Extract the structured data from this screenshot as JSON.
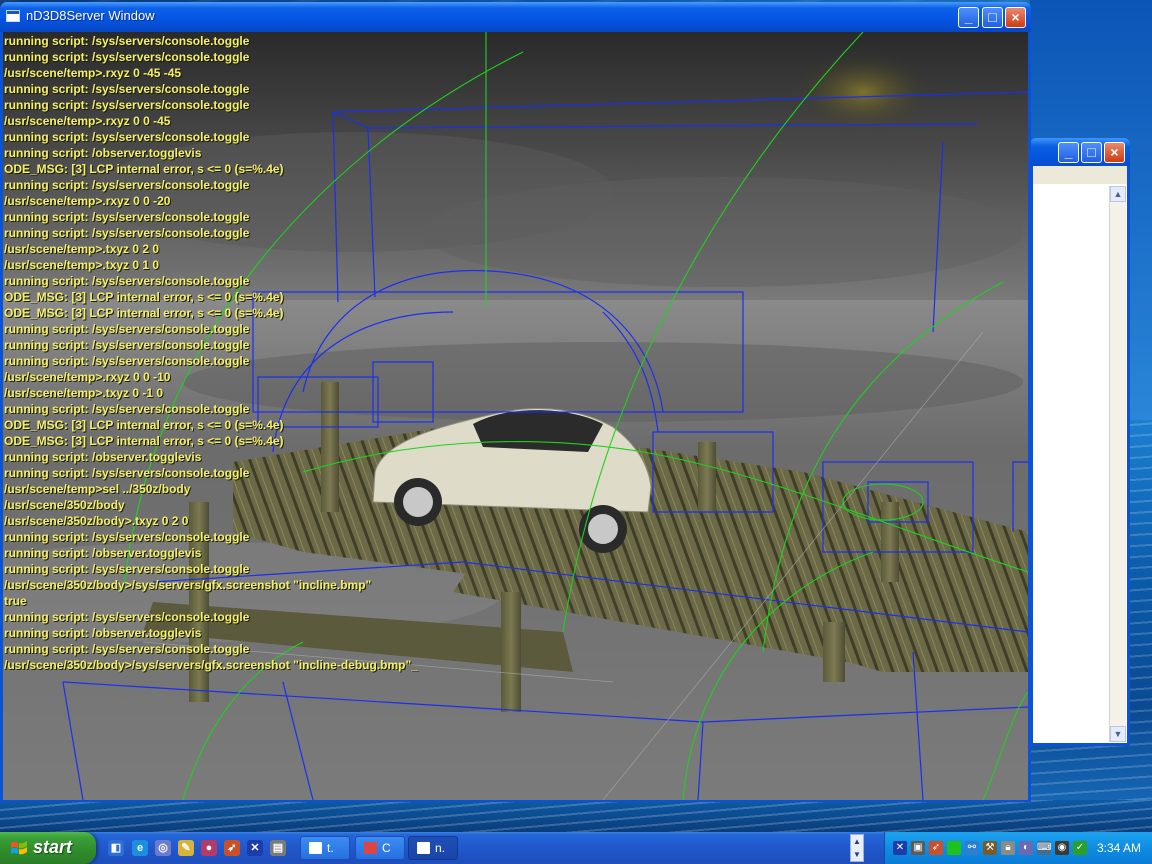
{
  "window": {
    "title": "nD3D8Server Window",
    "minimize_glyph": "_",
    "maximize_glyph": "□",
    "close_glyph": "×"
  },
  "console": {
    "lines": [
      "running script: /sys/servers/console.toggle",
      "running script: /sys/servers/console.toggle",
      "/usr/scene/temp>.rxyz 0 -45 -45",
      "running script: /sys/servers/console.toggle",
      "running script: /sys/servers/console.toggle",
      "/usr/scene/temp>.rxyz 0 0 -45",
      "running script: /sys/servers/console.toggle",
      "running script: /observer.togglevis",
      "ODE_MSG: [3] LCP internal error, s <= 0 (s=%.4e)",
      "running script: /sys/servers/console.toggle",
      "/usr/scene/temp>.rxyz 0 0 -20",
      "running script: /sys/servers/console.toggle",
      "running script: /sys/servers/console.toggle",
      "/usr/scene/temp>.txyz 0 2 0",
      "/usr/scene/temp>.txyz 0 1 0",
      "running script: /sys/servers/console.toggle",
      "ODE_MSG: [3] LCP internal error, s <= 0 (s=%.4e)",
      "ODE_MSG: [3] LCP internal error, s <= 0 (s=%.4e)",
      "running script: /sys/servers/console.toggle",
      "running script: /sys/servers/console.toggle",
      "running script: /sys/servers/console.toggle",
      "/usr/scene/temp>.rxyz 0 0 -10",
      "/usr/scene/temp>.txyz 0 -1 0",
      "running script: /sys/servers/console.toggle",
      "ODE_MSG: [3] LCP internal error, s <= 0 (s=%.4e)",
      "ODE_MSG: [3] LCP internal error, s <= 0 (s=%.4e)",
      "running script: /observer.togglevis",
      "running script: /sys/servers/console.toggle",
      "/usr/scene/temp>sel ../350z/body",
      "/usr/scene/350z/body",
      "/usr/scene/350z/body>.txyz 0 2 0",
      "running script: /sys/servers/console.toggle",
      "running script: /observer.togglevis",
      "running script: /sys/servers/console.toggle",
      "/usr/scene/350z/body>/sys/servers/gfx.screenshot \"incline.bmp\"",
      "true",
      "running script: /sys/servers/console.toggle",
      "running script: /observer.togglevis",
      "running script: /sys/servers/console.toggle",
      "/usr/scene/350z/body>/sys/servers/gfx.screenshot \"incline-debug.bmp\"_"
    ]
  },
  "taskbar": {
    "start_label": "start",
    "tasks": [
      {
        "label": "t."
      },
      {
        "label": "C"
      },
      {
        "label": "n."
      }
    ],
    "clock": "3:34 AM"
  },
  "colors": {
    "console_text": "#f4f06a",
    "xp_blue": "#0554e3",
    "start_green": "#3a9d36",
    "wire_blue": "#1a2ff0",
    "wire_green": "#1fd01f"
  }
}
